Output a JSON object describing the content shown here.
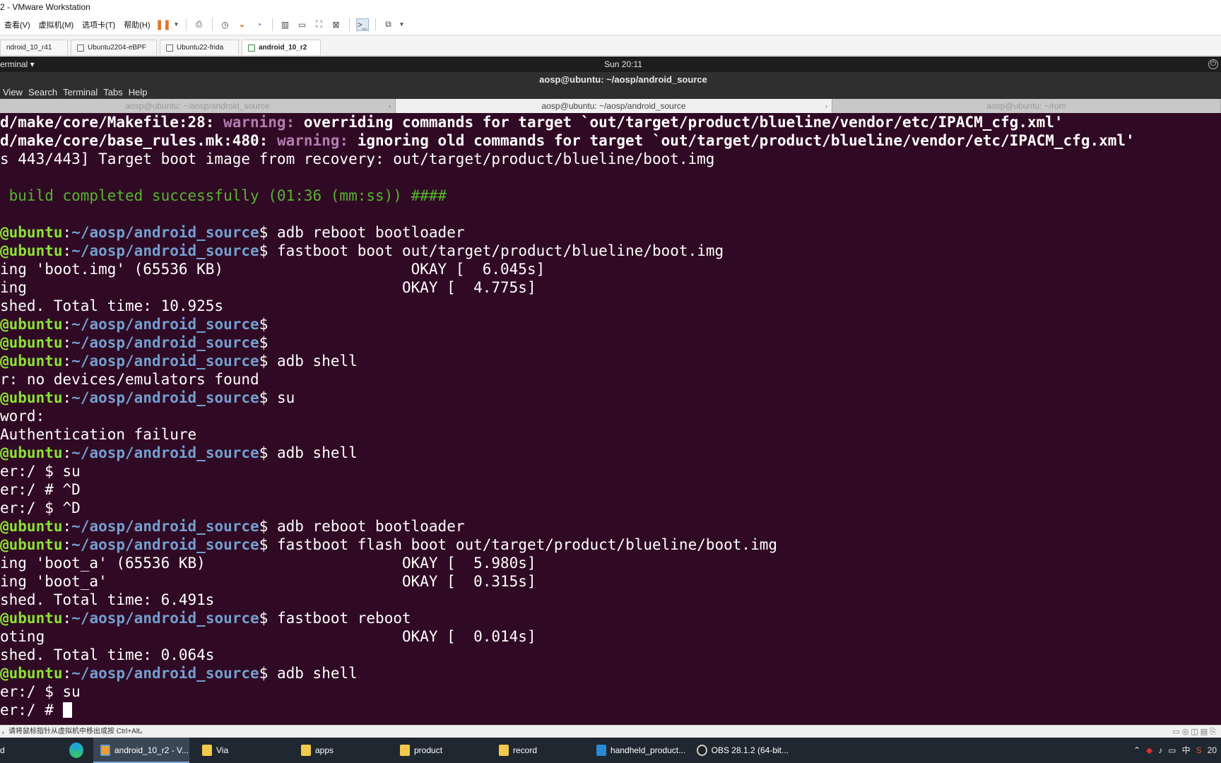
{
  "vmware": {
    "title": "2 - VMware Workstation",
    "menu": [
      "查看(V)",
      "虚拟机(M)",
      "选项卡(T)",
      "帮助(H)"
    ],
    "tabs": [
      {
        "label": "ndroid_10_r41",
        "active": false
      },
      {
        "label": "Ubuntu2204-eBPF",
        "active": false
      },
      {
        "label": "Ubuntu22-frida",
        "active": false
      },
      {
        "label": "android_10_r2",
        "active": true
      }
    ],
    "status_text": "，请将鼠标指针从虚拟机中移出或按 Ctrl+Alt。"
  },
  "gnome": {
    "app_menu": "erminal ▾",
    "clock": "Sun 20:11"
  },
  "terminal": {
    "window_title": "aosp@ubuntu: ~/aosp/android_source",
    "menu": [
      "View",
      "Search",
      "Terminal",
      "Tabs",
      "Help"
    ],
    "tabs": [
      {
        "label": "aosp@ubuntu: ~/aosp/android_source",
        "active": false
      },
      {
        "label": "aosp@ubuntu: ~/aosp/android_source",
        "active": true
      },
      {
        "label": "aosp@ubuntu: ~/rom",
        "active": false
      }
    ],
    "lines": [
      {
        "type": "warn",
        "pre": "d/make/core/Makefile:28: ",
        "warn": "warning:",
        "post": " overriding commands for target `out/target/product/blueline/vendor/etc/IPACM_cfg.xml'"
      },
      {
        "type": "warn",
        "pre": "d/make/core/base_rules.mk:480: ",
        "warn": "warning:",
        "post": " ignoring old commands for target `out/target/product/blueline/vendor/etc/IPACM_cfg.xml'"
      },
      {
        "type": "plain",
        "text": "s 443/443] Target boot image from recovery: out/target/product/blueline/boot.img"
      },
      {
        "type": "plain",
        "text": ""
      },
      {
        "type": "green",
        "text": " build completed successfully (01:36 (mm:ss)) ####"
      },
      {
        "type": "plain",
        "text": ""
      },
      {
        "type": "prompt",
        "user": "@ubuntu",
        "path": "~/aosp/android_source",
        "cmd": " adb reboot bootloader"
      },
      {
        "type": "prompt",
        "user": "@ubuntu",
        "path": "~/aosp/android_source",
        "cmd": " fastboot boot out/target/product/blueline/boot.img"
      },
      {
        "type": "plain",
        "text": "ing 'boot.img' (65536 KB)                     OKAY [  6.045s]"
      },
      {
        "type": "plain",
        "text": "ing                                          OKAY [  4.775s]"
      },
      {
        "type": "plain",
        "text": "shed. Total time: 10.925s"
      },
      {
        "type": "prompt",
        "user": "@ubuntu",
        "path": "~/aosp/android_source",
        "cmd": ""
      },
      {
        "type": "prompt",
        "user": "@ubuntu",
        "path": "~/aosp/android_source",
        "cmd": ""
      },
      {
        "type": "prompt",
        "user": "@ubuntu",
        "path": "~/aosp/android_source",
        "cmd": " adb shell"
      },
      {
        "type": "plain",
        "text": "r: no devices/emulators found"
      },
      {
        "type": "prompt",
        "user": "@ubuntu",
        "path": "~/aosp/android_source",
        "cmd": " su"
      },
      {
        "type": "plain",
        "text": "word:"
      },
      {
        "type": "plain",
        "text": "Authentication failure"
      },
      {
        "type": "prompt",
        "user": "@ubuntu",
        "path": "~/aosp/android_source",
        "cmd": " adb shell"
      },
      {
        "type": "plain",
        "text": "er:/ $ su"
      },
      {
        "type": "plain",
        "text": "er:/ # ^D"
      },
      {
        "type": "plain",
        "text": "er:/ $ ^D"
      },
      {
        "type": "prompt",
        "user": "@ubuntu",
        "path": "~/aosp/android_source",
        "cmd": " adb reboot bootloader"
      },
      {
        "type": "prompt",
        "user": "@ubuntu",
        "path": "~/aosp/android_source",
        "cmd": " fastboot flash boot out/target/product/blueline/boot.img"
      },
      {
        "type": "plain",
        "text": "ing 'boot_a' (65536 KB)                      OKAY [  5.980s]"
      },
      {
        "type": "plain",
        "text": "ing 'boot_a'                                 OKAY [  0.315s]"
      },
      {
        "type": "plain",
        "text": "shed. Total time: 6.491s"
      },
      {
        "type": "prompt",
        "user": "@ubuntu",
        "path": "~/aosp/android_source",
        "cmd": " fastboot reboot"
      },
      {
        "type": "plain",
        "text": "oting                                        OKAY [  0.014s]"
      },
      {
        "type": "plain",
        "text": "shed. Total time: 0.064s"
      },
      {
        "type": "prompt",
        "user": "@ubuntu",
        "path": "~/aosp/android_source",
        "cmd": " adb shell"
      },
      {
        "type": "plain",
        "text": "er:/ $ su"
      },
      {
        "type": "cursor",
        "text": "er:/ # "
      }
    ]
  },
  "taskbar": {
    "items": [
      {
        "label": "d",
        "icon": "none"
      },
      {
        "label": "",
        "icon": "edge-icon"
      },
      {
        "label": "android_10_r2 - V...",
        "icon": "vmware-icon",
        "active": true
      },
      {
        "label": "Via",
        "icon": "folder-icon"
      },
      {
        "label": "apps",
        "icon": "folder-icon"
      },
      {
        "label": "product",
        "icon": "folder-icon"
      },
      {
        "label": "record",
        "icon": "folder-icon"
      },
      {
        "label": "handheld_product...",
        "icon": "vscode-icon"
      },
      {
        "label": "OBS 28.1.2 (64-bit...",
        "icon": "obs-icon"
      }
    ],
    "tray": {
      "ime": "中",
      "clock": "20"
    }
  }
}
